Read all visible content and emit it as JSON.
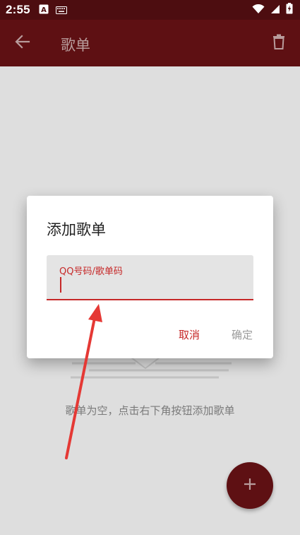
{
  "status_bar": {
    "time": "2:55",
    "icons": [
      "a-icon",
      "keyboard-icon",
      "wifi-icon",
      "signal-icon",
      "battery-charging-icon"
    ]
  },
  "app_bar": {
    "title": "歌单",
    "back_icon": "back-arrow-icon",
    "delete_icon": "trash-icon"
  },
  "empty_state": {
    "message": "歌单为空，点击右下角按钮添加歌单"
  },
  "fab": {
    "icon": "plus-icon"
  },
  "dialog": {
    "title": "添加歌单",
    "input": {
      "label": "QQ号码/歌单码",
      "value": ""
    },
    "cancel_label": "取消",
    "confirm_label": "确定"
  },
  "colors": {
    "status_bar": "#4d0d10",
    "app_bar": "#5e1013",
    "accent": "#c62828",
    "annotation_arrow": "#e53935"
  }
}
